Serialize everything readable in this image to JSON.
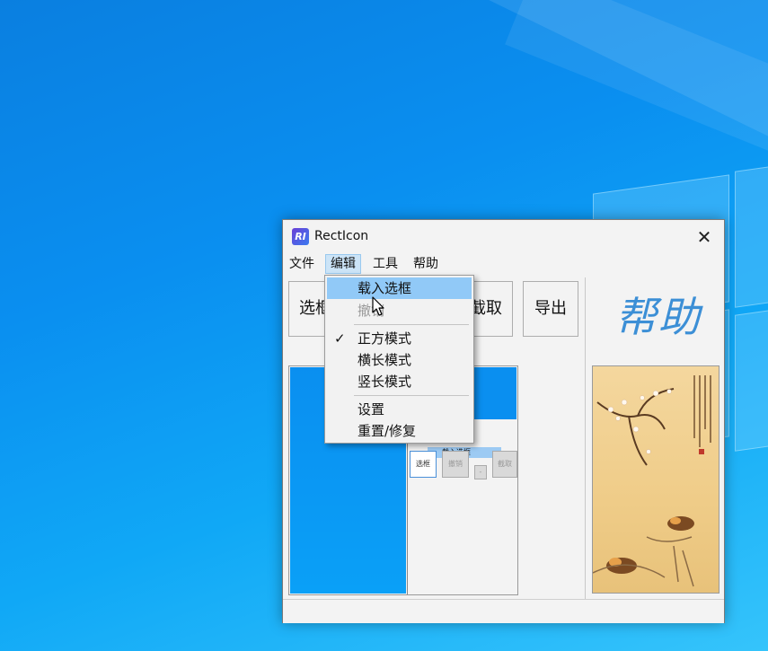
{
  "window": {
    "title": "RectIcon",
    "app_icon_text": "RI",
    "close_symbol": "✕"
  },
  "menubar": {
    "items": [
      "文件",
      "编辑",
      "工具",
      "帮助"
    ],
    "open_index": 1
  },
  "toolbar": {
    "select_label": "选框",
    "crop_label": "截取",
    "export_label": "导出"
  },
  "dropdown": {
    "items": [
      {
        "label": "载入选框",
        "state": "highlighted"
      },
      {
        "label": "撤销",
        "state": "disabled"
      },
      {
        "label": "正方模式",
        "state": "checked"
      },
      {
        "label": "横长模式",
        "state": "normal"
      },
      {
        "label": "竖长模式",
        "state": "normal"
      },
      {
        "label": "设置",
        "state": "normal"
      },
      {
        "label": "重置/修复",
        "state": "normal"
      }
    ],
    "check_symbol": "✓"
  },
  "help": {
    "label": "帮助"
  },
  "preview": {
    "mini_select": "选框",
    "mini_undo": "撤销",
    "mini_crop": "截取",
    "mini_menu_item": "载入选框"
  },
  "colors": {
    "accent": "#3c8fd6",
    "highlight": "#91c9f7",
    "menu_open": "#cce4f7",
    "desktop": "#0a8ff0"
  },
  "icons": {
    "app": "recticon-app-icon",
    "close": "close-icon",
    "check": "checkmark-icon",
    "cursor": "mouse-pointer-icon"
  }
}
